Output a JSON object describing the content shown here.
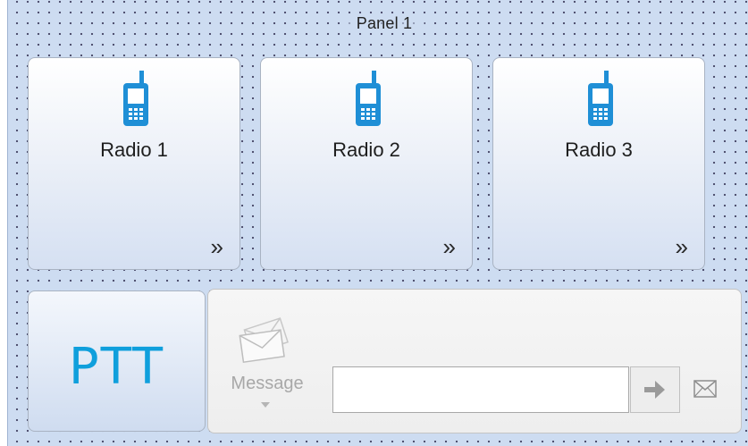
{
  "panel": {
    "title": "Panel 1"
  },
  "radios": [
    {
      "label": "Radio 1",
      "icon": "radio-handset-icon",
      "expand_icon": "double-chevron-right-icon",
      "expand_glyph": "»"
    },
    {
      "label": "Radio 2",
      "icon": "radio-handset-icon",
      "expand_icon": "double-chevron-right-icon",
      "expand_glyph": "»"
    },
    {
      "label": "Radio 3",
      "icon": "radio-handset-icon",
      "expand_icon": "double-chevron-right-icon",
      "expand_glyph": "»"
    }
  ],
  "ptt": {
    "label": "PTT",
    "color": "#0f9fdc"
  },
  "message": {
    "label": "Message",
    "icon": "envelopes-icon",
    "input_value": "",
    "send_icon": "arrow-right-icon",
    "mail_icon": "envelope-icon"
  },
  "colors": {
    "panel_background": "#cddcf1",
    "radio_icon": "#1f8fd6",
    "disabled_text": "#a8a8a8"
  }
}
